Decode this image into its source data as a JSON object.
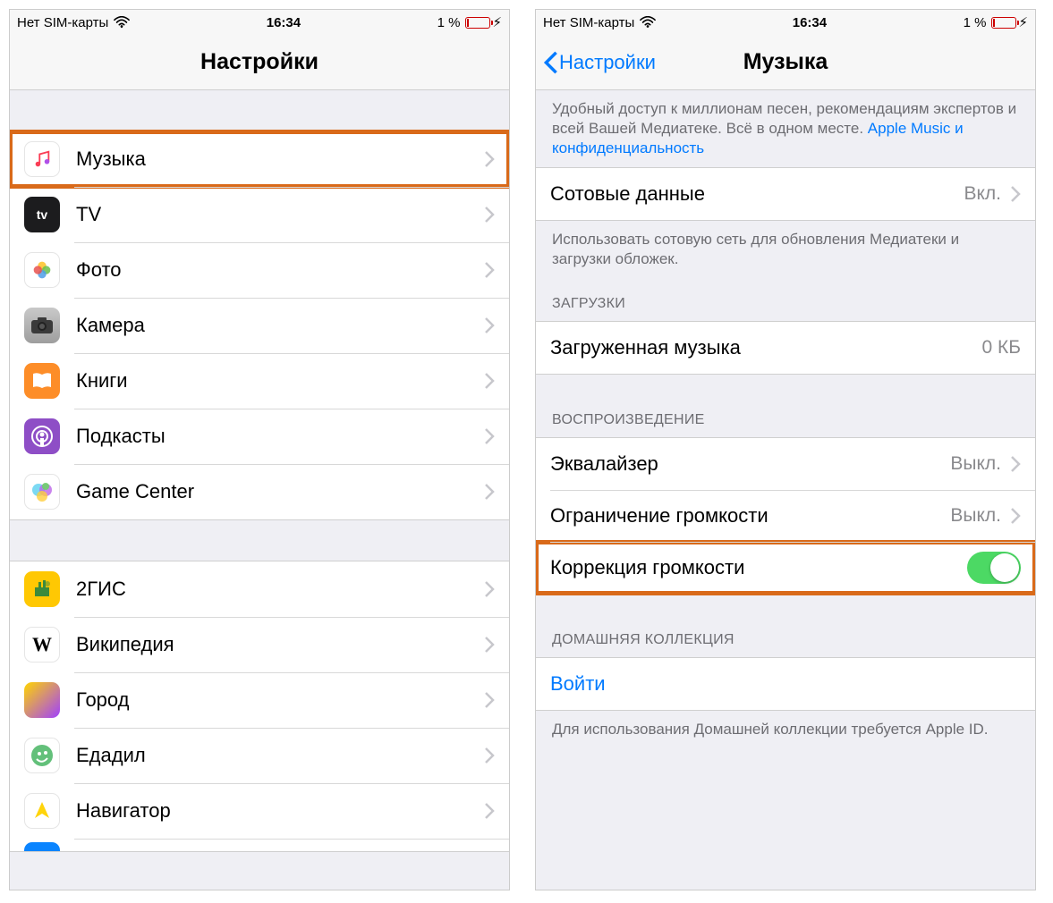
{
  "status": {
    "carrier": "Нет SIM-карты",
    "time": "16:34",
    "battery_pct": "1 %"
  },
  "left": {
    "title": "Настройки",
    "group1": [
      {
        "label": "Музыка"
      },
      {
        "label": "TV"
      },
      {
        "label": "Фото"
      },
      {
        "label": "Камера"
      },
      {
        "label": "Книги"
      },
      {
        "label": "Подкасты"
      },
      {
        "label": "Game Center"
      }
    ],
    "group2": [
      {
        "label": "2ГИС"
      },
      {
        "label": "Википедия"
      },
      {
        "label": "Город"
      },
      {
        "label": "Едадил"
      },
      {
        "label": "Навигатор"
      }
    ]
  },
  "right": {
    "back": "Настройки",
    "title": "Музыка",
    "intro_text": "Удобный доступ к миллионам песен, рекомендациям экспертов и всей Вашей Медиатеке. Всё в одном месте. ",
    "intro_link": "Apple Music и конфиденциальность",
    "cellular": {
      "label": "Сотовые данные",
      "value": "Вкл."
    },
    "cellular_footer": "Использовать сотовую сеть для обновления Медиатеки и загрузки обложек.",
    "downloads_header": "ЗАГРУЗКИ",
    "downloaded": {
      "label": "Загруженная музыка",
      "value": "0 КБ"
    },
    "playback_header": "ВОСПРОИЗВЕДЕНИЕ",
    "eq": {
      "label": "Эквалайзер",
      "value": "Выкл."
    },
    "volume_limit": {
      "label": "Ограничение громкости",
      "value": "Выкл."
    },
    "sound_check": {
      "label": "Коррекция громкости"
    },
    "home_header": "ДОМАШНЯЯ КОЛЛЕКЦИЯ",
    "signin": "Войти",
    "home_footer": "Для использования Домашней коллекции требуется Apple ID."
  }
}
